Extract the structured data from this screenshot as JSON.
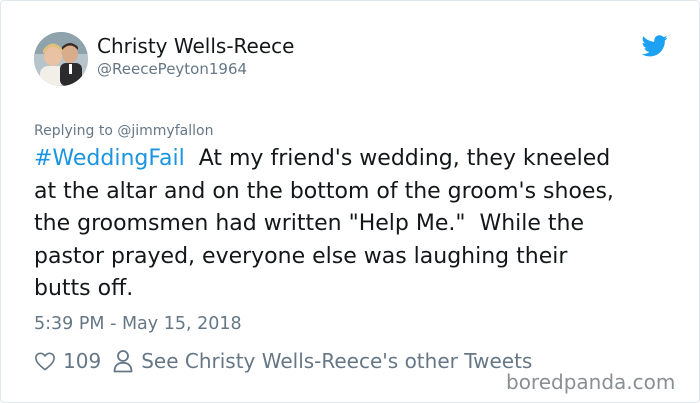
{
  "author": {
    "name": "Christy Wells-Reece",
    "handle": "@ReecePeyton1964"
  },
  "reply_to": "Replying to @jimmyfallon",
  "tweet": {
    "hashtag": "#WeddingFail",
    "line1_rest": "  At my friend's wedding, they kneeled",
    "line2": "at the altar and on the bottom of the groom's shoes,",
    "line3": "the groomsmen had written \"Help Me.\"  While the",
    "line4": "pastor prayed, everyone else was laughing their",
    "line5": "butts off."
  },
  "timestamp": "5:39 PM - May 15, 2018",
  "actions": {
    "like_count": "109",
    "see_other": "See Christy Wells-Reece's other Tweets"
  },
  "watermark": "boredpanda.com",
  "colors": {
    "text": "#14171a",
    "secondary": "#657786",
    "link": "#1b95e0",
    "twitter_blue": "#1da1f2",
    "border": "#e1e8ed"
  },
  "icons": [
    "twitter-bird-icon",
    "heart-icon",
    "person-icon"
  ]
}
